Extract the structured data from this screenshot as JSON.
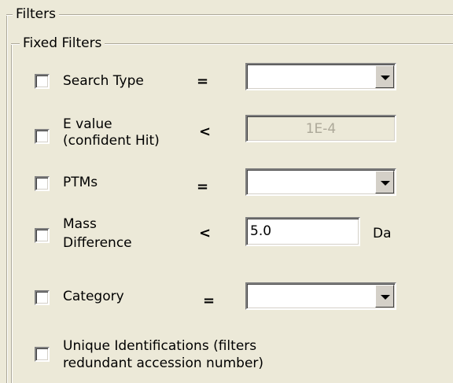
{
  "filters": {
    "group_title": "Filters",
    "fixed_group_title": "Fixed Filters",
    "rows": [
      {
        "label": "Search Type",
        "operator": "=",
        "value": ""
      },
      {
        "label_line1": "E value",
        "label_line2": "(confident Hit)",
        "operator": "<",
        "value": "1E-4"
      },
      {
        "label": "PTMs",
        "operator": "=",
        "value": ""
      },
      {
        "label_line1": "Mass",
        "label_line2": "Difference",
        "operator": "<",
        "value": "5.0",
        "unit": "Da"
      },
      {
        "label": "Category",
        "operator": "=",
        "value": ""
      },
      {
        "label_line1": "Unique Identifications (filters",
        "label_line2": "redundant accession number)"
      }
    ]
  }
}
